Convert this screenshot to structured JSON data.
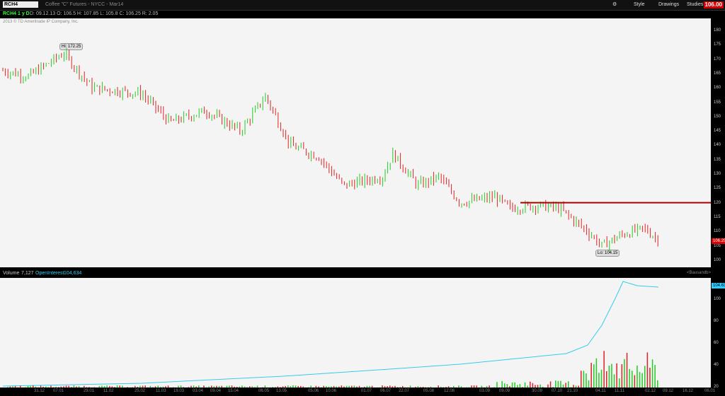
{
  "toolbar": {
    "symbol": "RCH4",
    "description": "Coffee \"C\" Futures - NYCC - Mar14",
    "style": "Style",
    "drawings": "Drawings",
    "studies": "Studies",
    "last_price": "106.00"
  },
  "infobar": {
    "symbol": "RCH4 1 y D",
    "ohlc": "D: 09.12.13  O: 106.5  H: 107.85  L: 105.8  C: 106.25  R: 2.05"
  },
  "copyright": "2013 © TD Ameritrade IP Company, Inc.",
  "price": {
    "ticks": [
      "180",
      "175",
      "170",
      "165",
      "160",
      "155",
      "150",
      "145",
      "140",
      "135",
      "130",
      "125",
      "120",
      "115",
      "110",
      "105",
      "100"
    ],
    "hi_label": "Hi: 172.25",
    "lo_label": "Lo: 104.15",
    "current_tag": "106.25",
    "colors": {
      "up": "#2c2",
      "down": "#d22",
      "resistance": "#a00"
    }
  },
  "volume": {
    "header_volume": "Volume",
    "volume_value": "7,127",
    "oi_label": "OpenInterest",
    "oi_value": "104,634",
    "oi_tag": "104.63",
    "right_label": "<Bausandb>",
    "ticks": [
      "100",
      "80",
      "60",
      "40",
      "20"
    ],
    "colors": {
      "oi": "#3ce",
      "vol": "#d22"
    }
  },
  "xaxis": [
    "31.12",
    "07.01",
    "29.01",
    "11.02",
    "25.02",
    "11.03",
    "19.03",
    "03.04",
    "09.04",
    "15.04",
    "06.05",
    "13.05",
    "05.06",
    "10.06",
    "01.07",
    "06.07",
    "22.07",
    "05.08",
    "12.08",
    "03.09",
    "09.09",
    "30.09",
    "07.10",
    "21.10",
    "04.11",
    "11.11",
    "02.12",
    "09.12",
    "16.12",
    "06.01"
  ]
}
